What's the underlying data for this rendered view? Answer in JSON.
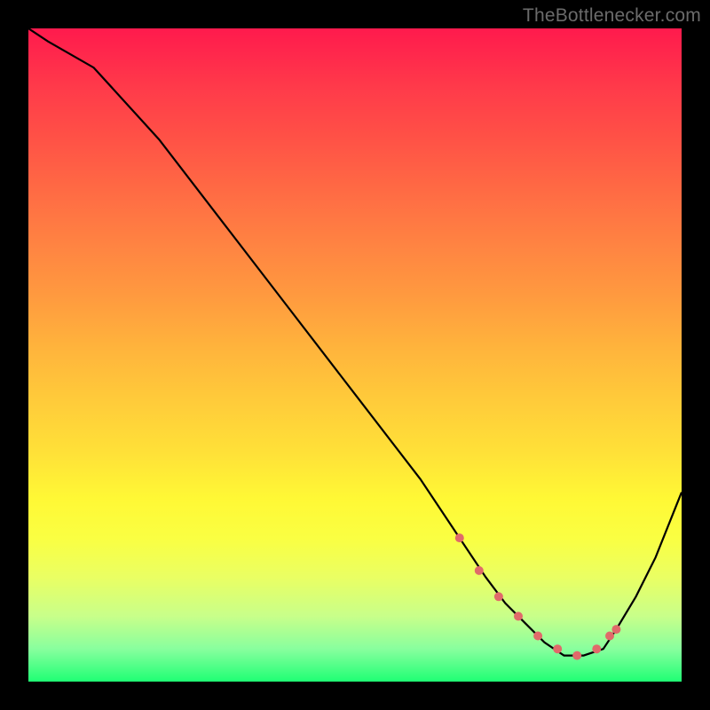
{
  "attribution": "TheBottlenecker.com",
  "chart_data": {
    "type": "line",
    "title": "",
    "xlabel": "",
    "ylabel": "",
    "xlim": [
      0,
      100
    ],
    "ylim": [
      0,
      100
    ],
    "series": [
      {
        "name": "curve",
        "x": [
          0,
          3,
          10,
          20,
          30,
          40,
          50,
          60,
          66,
          70,
          73,
          76,
          79,
          82,
          85,
          88,
          90,
          93,
          96,
          100
        ],
        "values": [
          100,
          98,
          94,
          83,
          70,
          57,
          44,
          31,
          22,
          16,
          12,
          9,
          6,
          4,
          4,
          5,
          8,
          13,
          19,
          29
        ]
      }
    ],
    "markers": {
      "name": "highlight-dots",
      "x": [
        66,
        69,
        72,
        75,
        78,
        81,
        84,
        87,
        89,
        90
      ],
      "values": [
        22,
        17,
        13,
        10,
        7,
        5,
        4,
        5,
        7,
        8
      ],
      "color": "#e06a6a",
      "radius_px": 5
    },
    "background": {
      "type": "vertical-gradient",
      "stops": [
        {
          "pct": 0,
          "color": "#ff1a4d"
        },
        {
          "pct": 50,
          "color": "#ffb43c"
        },
        {
          "pct": 75,
          "color": "#fff835"
        },
        {
          "pct": 100,
          "color": "#1fff74"
        }
      ]
    }
  }
}
